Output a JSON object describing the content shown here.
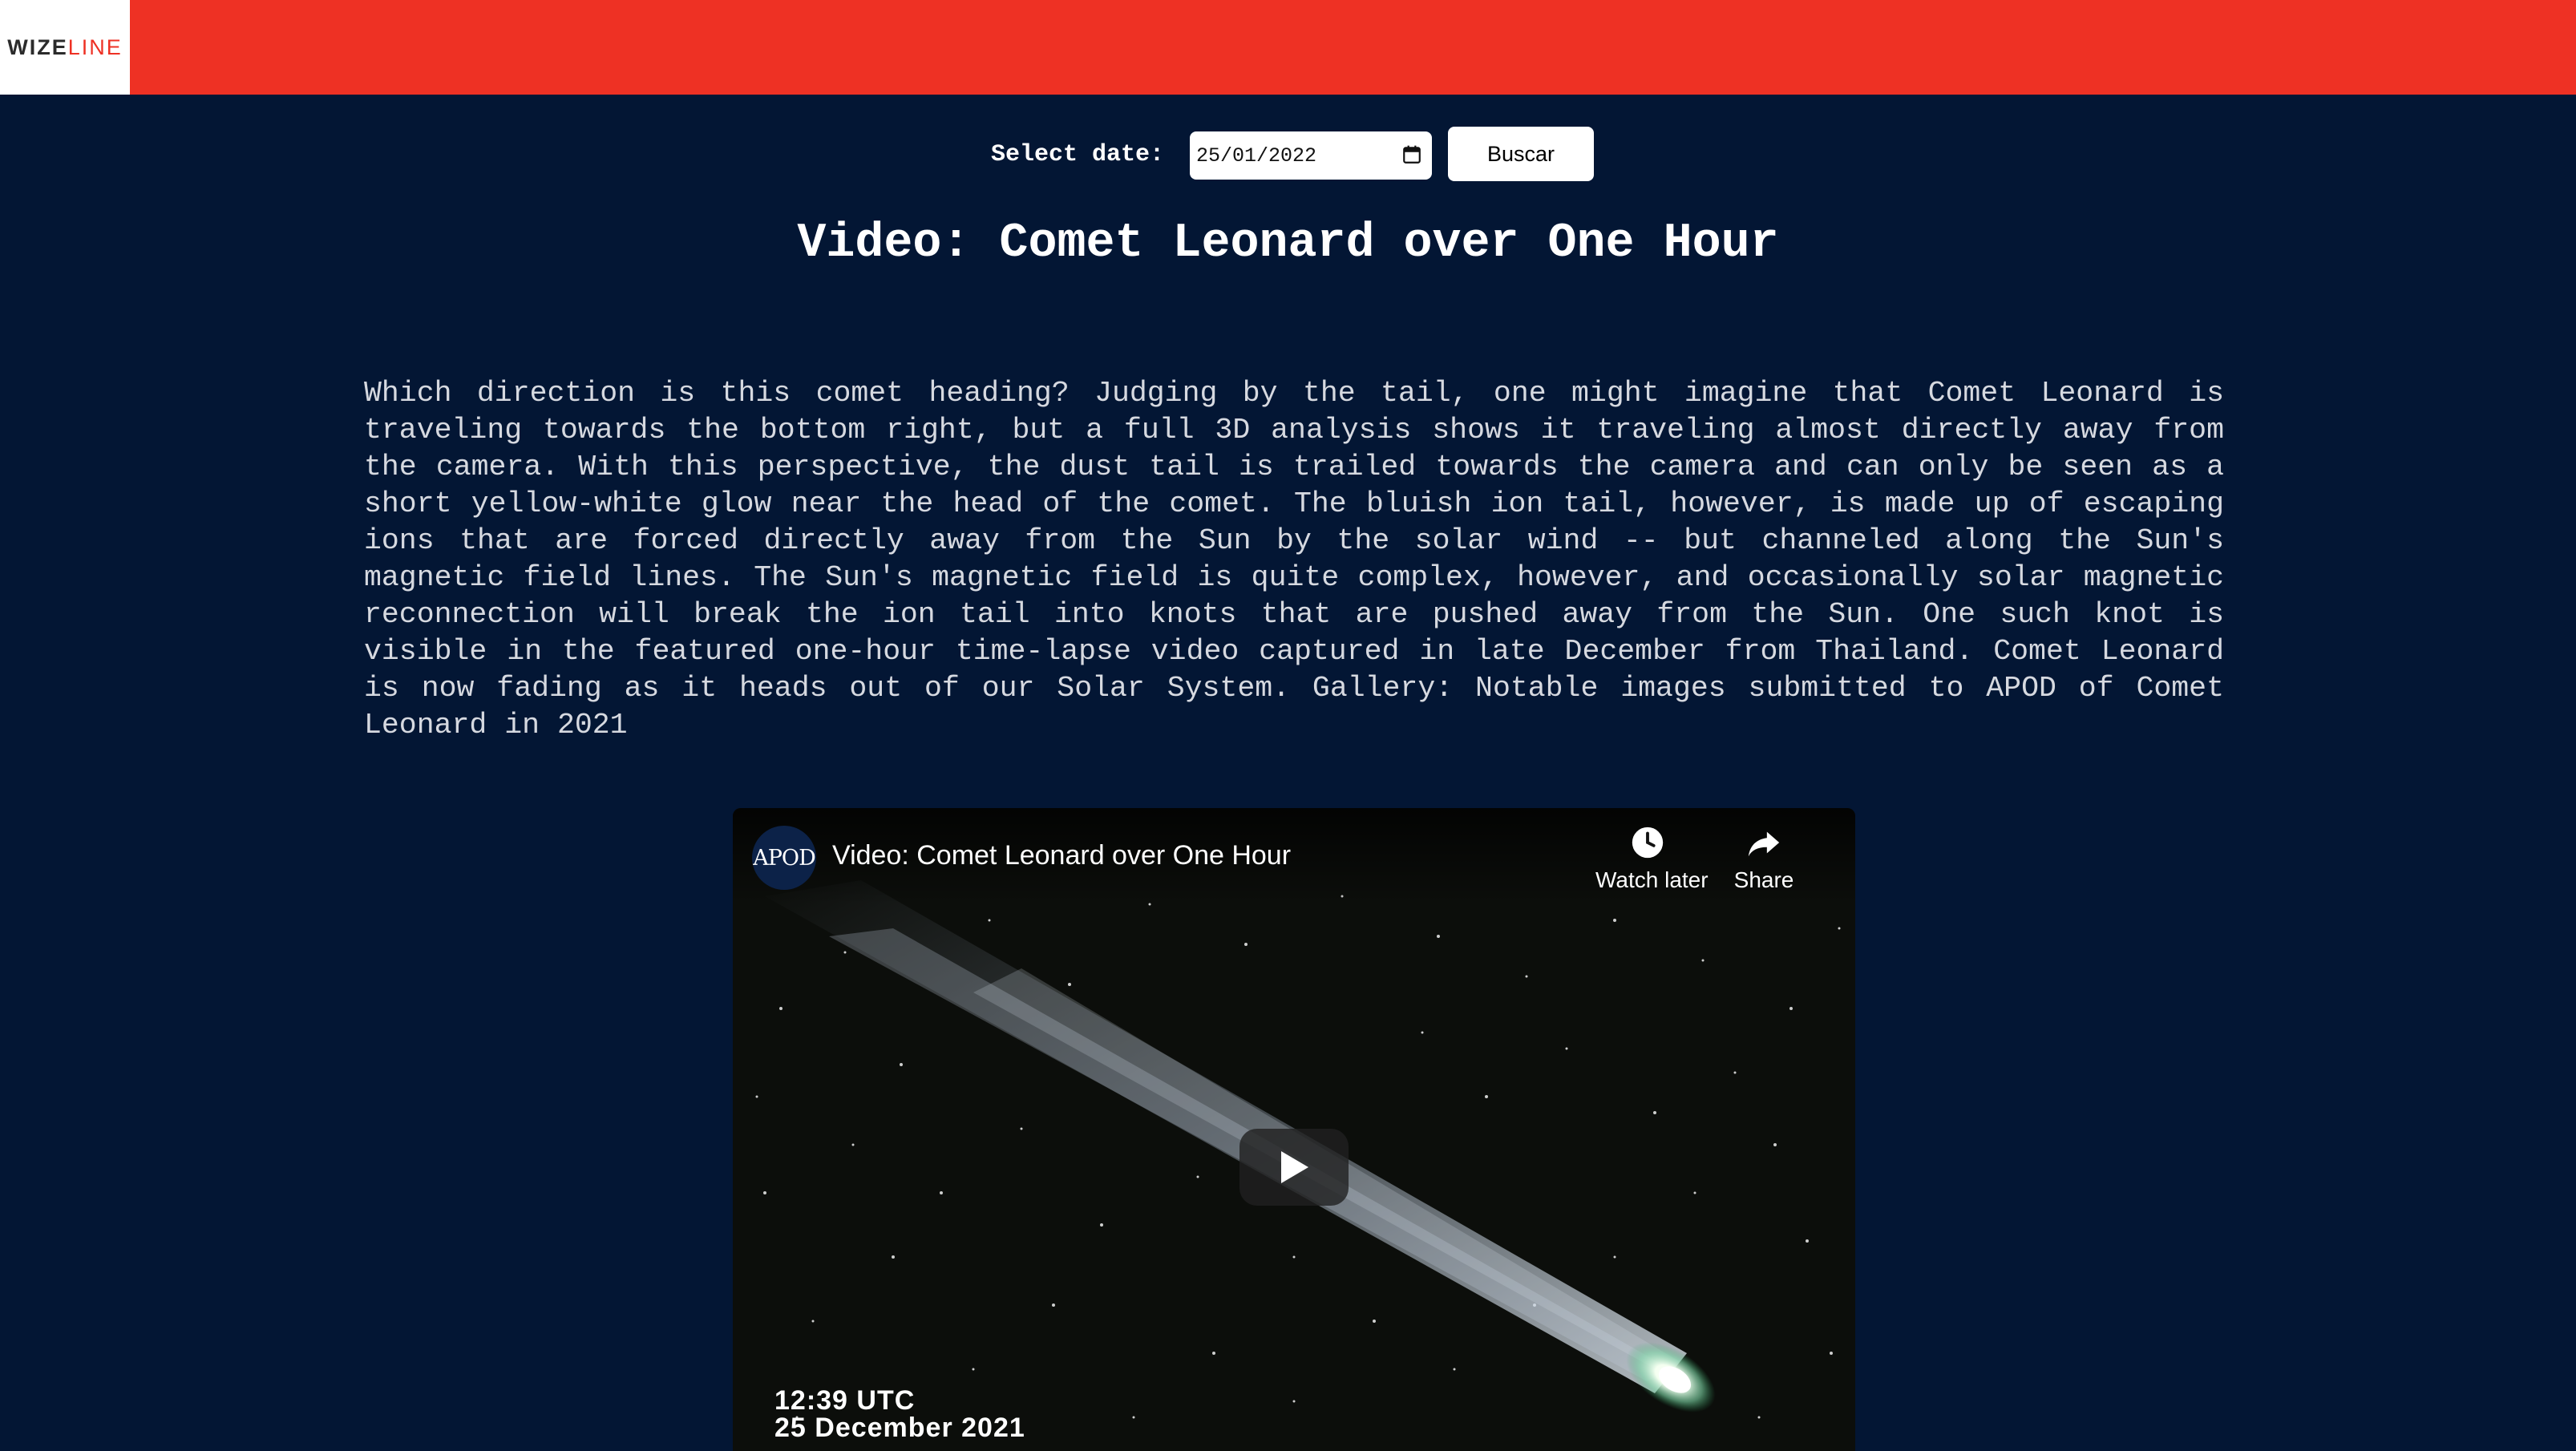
{
  "header": {
    "logo_wize": "WIZE",
    "logo_line": "LINE",
    "bar_color": "#ee3124"
  },
  "date_form": {
    "label": "Select date:",
    "value": "25/01/2022",
    "calendar_icon": "calendar-icon",
    "search_button": "Buscar"
  },
  "article": {
    "title": "Video: Comet Leonard over One Hour",
    "explanation": "Which direction is this comet heading? Judging by the tail, one might imagine that Comet Leonard is traveling towards the bottom right, but a full 3D analysis shows it traveling almost directly away from the camera. With this perspective, the dust tail is trailed towards the camera and can only be seen as a short yellow-white glow near the head of the comet. The bluish ion tail, however, is made up of escaping ions that are forced directly away from the Sun by the solar wind -- but channeled along the Sun's magnetic field lines. The Sun's magnetic field is quite complex, however, and occasionally solar magnetic reconnection will break the ion tail into knots that are pushed away from the Sun. One such knot is visible in the featured one-hour time-lapse video captured in late December from Thailand. Comet Leonard is now fading as it heads out of our Solar System. Gallery: Notable images submitted to APOD of Comet Leonard in 2021"
  },
  "video": {
    "channel_avatar": "APOD",
    "title": "Video: Comet Leonard over One Hour",
    "watch_later": "Watch later",
    "share": "Share",
    "overlay_time": "12:39 UTC",
    "overlay_date": "25 December 2021",
    "icons": [
      "clock-icon",
      "share-arrow-icon",
      "play-icon"
    ]
  },
  "colors": {
    "page_background": "#031634",
    "accent": "#ee3124"
  }
}
